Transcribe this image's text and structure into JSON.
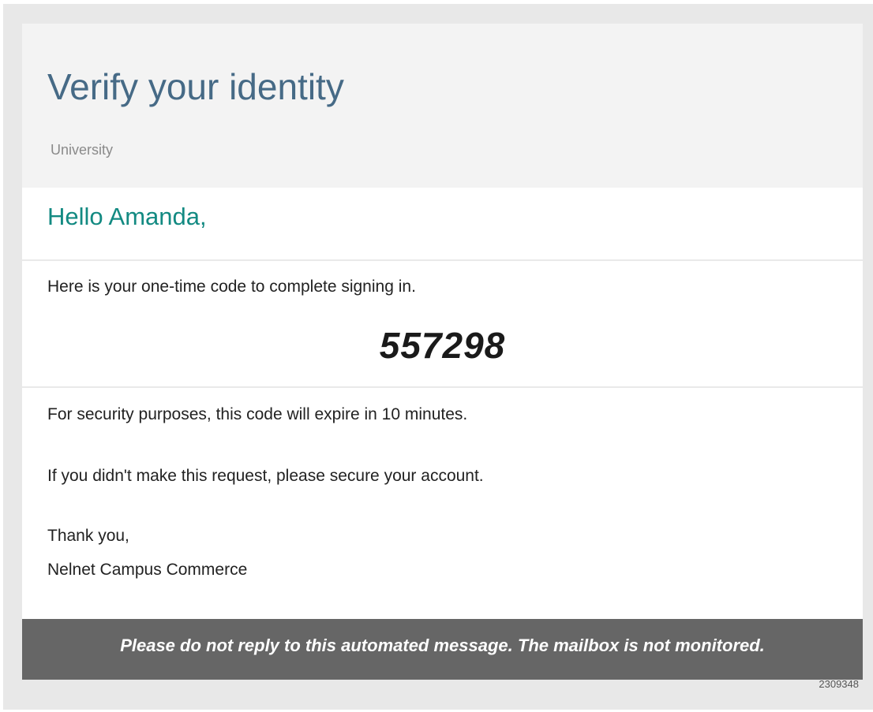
{
  "email": {
    "title": "Verify your identity",
    "organization": "University",
    "greeting": "Hello Amanda,",
    "intro": "Here is your one-time code to complete signing in.",
    "code": "557298",
    "expiry_notice": "For security purposes, this code will expire in 10 minutes.",
    "security_notice": "If you didn't make this request, please secure your account.",
    "closing": "Thank you,",
    "sender": "Nelnet Campus Commerce",
    "footer_notice": "Please do not reply to this automated message. The mailbox is not monitored.",
    "reference_id": "2309348"
  },
  "colors": {
    "title": "#466a86",
    "greeting": "#138a82",
    "header_bg": "#f3f3f3",
    "footer_bg": "#666666",
    "frame_bg": "#e8e8e8"
  }
}
